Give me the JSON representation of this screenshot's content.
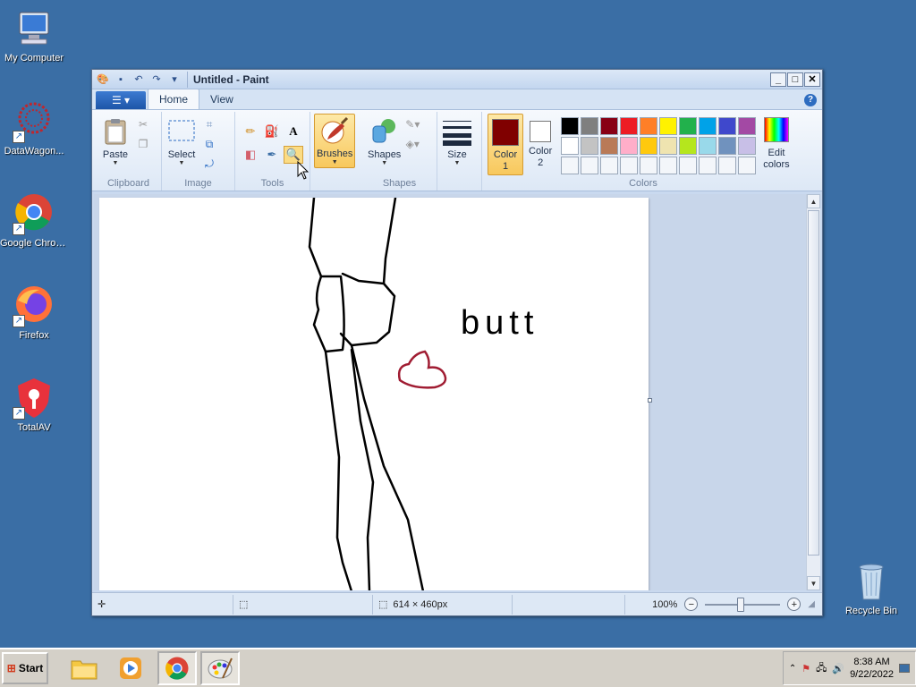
{
  "desktop": {
    "icons": [
      {
        "label": "My Computer",
        "icon": "computer-icon"
      },
      {
        "label": "DataWagon...",
        "icon": "datawagon-icon"
      },
      {
        "label": "Google Chrome",
        "icon": "chrome-icon"
      },
      {
        "label": "Firefox",
        "icon": "firefox-icon"
      },
      {
        "label": "TotalAV",
        "icon": "totalav-icon"
      },
      {
        "label": "Recycle Bin",
        "icon": "recycle-bin-icon"
      }
    ]
  },
  "window": {
    "title": "Untitled - Paint",
    "tabs": [
      "Home",
      "View"
    ],
    "active_tab": "Home"
  },
  "ribbon": {
    "clipboard": {
      "paste": "Paste",
      "label": "Clipboard"
    },
    "image": {
      "select": "Select",
      "label": "Image"
    },
    "tools": {
      "label": "Tools"
    },
    "brushes": "Brushes",
    "shapes": {
      "button": "Shapes",
      "label": "Shapes"
    },
    "size": "Size",
    "color1": {
      "line1": "Color",
      "line2": "1",
      "value": "#800000"
    },
    "color2": {
      "line1": "Color",
      "line2": "2",
      "value": "#ffffff"
    },
    "colors_label": "Colors",
    "edit_colors": {
      "line1": "Edit",
      "line2": "colors"
    },
    "palette": [
      "#000000",
      "#7f7f7f",
      "#880015",
      "#ed1c24",
      "#ff7f27",
      "#fff200",
      "#22b14c",
      "#00a2e8",
      "#3f48cc",
      "#a349a4",
      "#ffffff",
      "#c3c3c3",
      "#b97a57",
      "#ffaec9",
      "#ffc90e",
      "#efe4b0",
      "#b5e61d",
      "#99d9ea",
      "#7092be",
      "#c8bfe7",
      "",
      "",
      "",
      "",
      "",
      "",
      "",
      "",
      "",
      ""
    ]
  },
  "canvas": {
    "text": "butt"
  },
  "statusbar": {
    "dimensions": "614 × 460px",
    "zoom": "100%"
  },
  "taskbar": {
    "start": "Start",
    "time": "8:38 AM",
    "date": "9/22/2022"
  }
}
